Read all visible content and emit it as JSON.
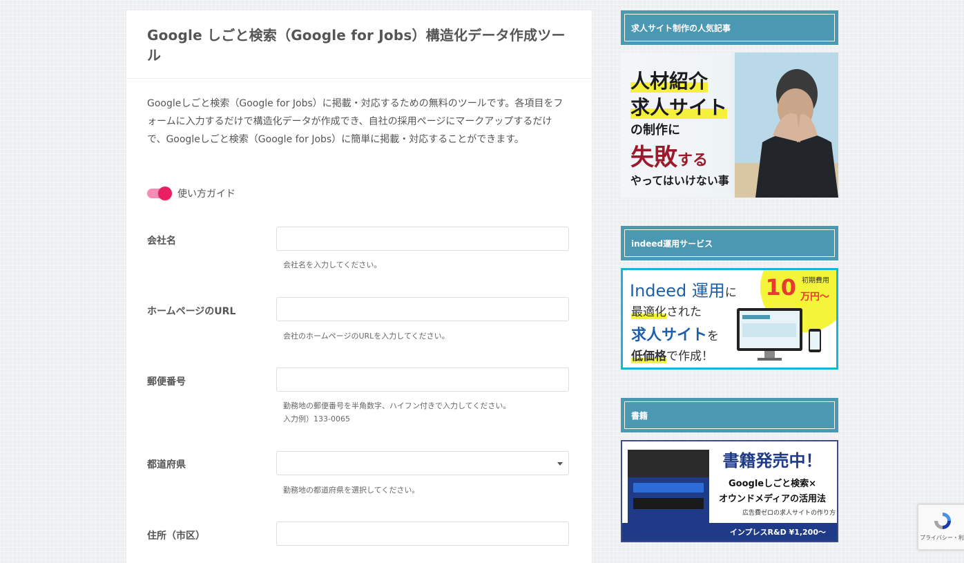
{
  "page": {
    "title": "Google しごと検索（Google for Jobs）構造化データ作成ツール",
    "intro": "Googleしごと検索（Google for Jobs）に掲載・対応するための無料のツールです。各項目をフォームに入力するだけで構造化データが作成でき、自社の採用ページにマークアップするだけで、Googleしごと検索（Google for Jobs）に簡単に掲載・対応することができます。"
  },
  "guide_toggle": {
    "label": "使い方ガイド",
    "on": true
  },
  "form": {
    "company": {
      "label": "会社名",
      "value": "",
      "help": "会社名を入力してください。"
    },
    "homepage": {
      "label": "ホームページのURL",
      "value": "",
      "help": "会社のホームページのURLを入力してください。"
    },
    "postal": {
      "label": "郵便番号",
      "value": "",
      "help": "勤務地の郵便番号を半角数字、ハイフン付きで入力してください。",
      "help2": "入力例）133-0065"
    },
    "prefecture": {
      "label": "都道府県",
      "value": "",
      "help": "勤務地の都道府県を選択してください。"
    },
    "address": {
      "label": "住所（市区）",
      "value": ""
    }
  },
  "sidebar": {
    "widget1": {
      "title": "求人サイト制作の人気記事",
      "banner": {
        "line1": "人材紹介",
        "line2": "求人サイト",
        "line3": "の制作に",
        "line4a": "失敗",
        "line4b": "する",
        "line5": "やってはいけない事"
      }
    },
    "widget2": {
      "title": "indeed運用サービス",
      "banner": {
        "word1": "Indeed 運用",
        "word1b": "に",
        "word2a": "最適化",
        "word2b": "された",
        "word3a": "求人サイト",
        "word3b": "を",
        "word4a": "低価格",
        "word4b": "で作成！",
        "price_label": "初期費用",
        "price_num": "10",
        "price_unit": "万円〜"
      }
    },
    "widget3": {
      "title": "書籍",
      "banner": {
        "headline": "書籍発売中！",
        "sub1": "Googleしごと検索×",
        "sub2": "オウンドメディアの活用法",
        "sub3": "広告費ゼロの求人サイトの作り方",
        "footer": "インプレスR&D ¥1,200〜"
      }
    }
  },
  "recaptcha": {
    "text": "プライバシー・利用規約"
  },
  "colors": {
    "accent": "#4b98b3",
    "toggle": "#e91e63"
  }
}
